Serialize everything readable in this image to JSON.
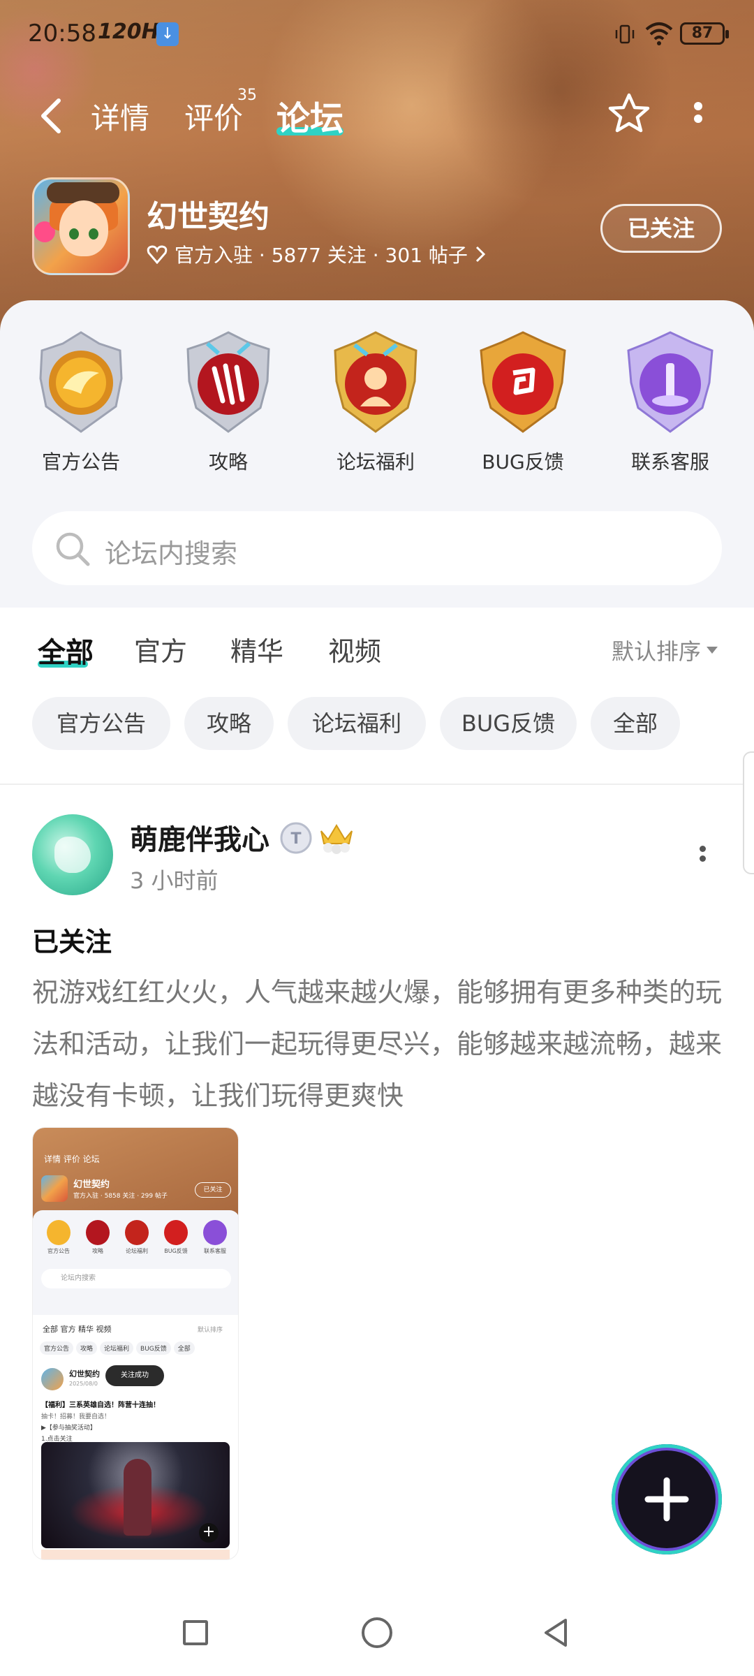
{
  "status_bar": {
    "time": "20:58",
    "refresh_rate": "120Hz",
    "battery": "87"
  },
  "nav": {
    "tabs": [
      {
        "label": "详情"
      },
      {
        "label": "评价",
        "count": "35"
      },
      {
        "label": "论坛"
      }
    ],
    "active_tab": "论坛",
    "accent_color": "#2fd2c4"
  },
  "game": {
    "name": "幻世契约",
    "meta": "官方入驻 · 5877 关注 · 301 帖子",
    "follow_label": "已关注"
  },
  "categories": [
    {
      "label": "官方公告",
      "icon": "gold-swirl-badge-icon"
    },
    {
      "label": "攻略",
      "icon": "claw-badge-icon"
    },
    {
      "label": "论坛福利",
      "icon": "hero-badge-icon"
    },
    {
      "label": "BUG反馈",
      "icon": "spiral-badge-icon"
    },
    {
      "label": "联系客服",
      "icon": "purple-crystal-badge-icon"
    }
  ],
  "search": {
    "placeholder": "论坛内搜索"
  },
  "filter_tabs": [
    {
      "label": "全部"
    },
    {
      "label": "官方"
    },
    {
      "label": "精华"
    },
    {
      "label": "视频"
    }
  ],
  "sort_label": "默认排序",
  "chips": [
    {
      "label": "官方公告"
    },
    {
      "label": "攻略"
    },
    {
      "label": "论坛福利"
    },
    {
      "label": "BUG反馈"
    },
    {
      "label": "全部"
    }
  ],
  "post": {
    "author": "萌鹿伴我心",
    "time": "3 小时前",
    "title": "已关注",
    "body": "祝游戏红红火火，人气越来越火爆，能够拥有更多种类的玩法和活动，让我们一起玩得更尽兴，能够越来越流畅，越来越没有卡顿，让我们玩得更爽快",
    "image": {
      "tabs": "详情   评价   论坛",
      "name": "幻世契约",
      "meta": "官方入驻 · 5858 关注 · 299 帖子",
      "follow": "已关注",
      "cats": [
        "官方公告",
        "攻略",
        "论坛福利",
        "BUG反馈",
        "联系客服"
      ],
      "search": "论坛内搜索",
      "ftabs": "全部   官方   精华   视频",
      "sort": "默认排序",
      "chips": [
        "官方公告",
        "攻略",
        "论坛福利",
        "BUG反馈",
        "全部"
      ],
      "author": "幻世契约",
      "date": "2025/08/0",
      "toast": "关注成功",
      "ptitle": "【福利】三系英雄自选！阵营十连抽！",
      "pl1": "抽卡！招募！我要自选！",
      "pl2": "▶【参与抽奖活动】",
      "pl3": "1.点击关注"
    }
  }
}
